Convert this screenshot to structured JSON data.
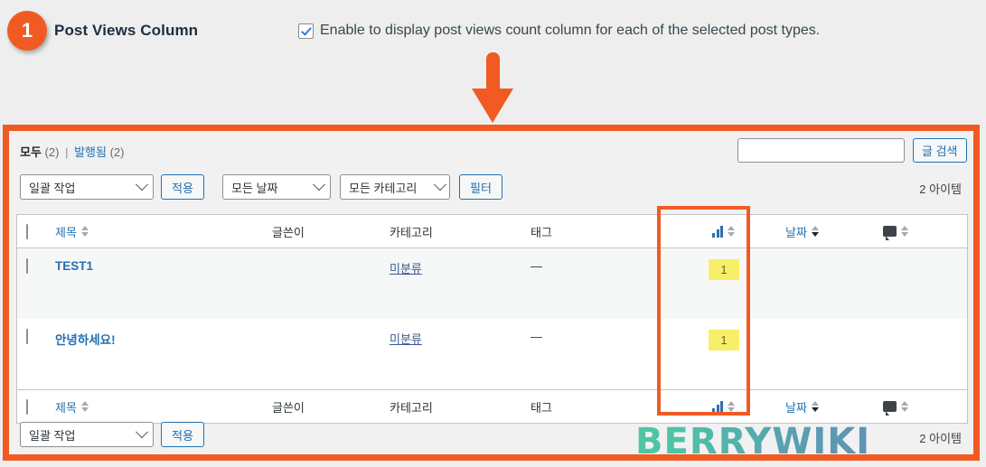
{
  "annotation": {
    "badge_number": "1",
    "title": "Post Views Column",
    "checkbox_label": "Enable to display post views count column for each of the selected post types.",
    "accent_color": "#f15a22",
    "arrow_icon": "arrow-down-icon"
  },
  "list_table": {
    "views_nav": {
      "all_label": "모두",
      "all_count": "(2)",
      "separator": "|",
      "published_label": "발행됨",
      "published_count": "(2)"
    },
    "search": {
      "value": "",
      "placeholder": "",
      "button_label": "글 검색"
    },
    "toolbar_top": {
      "bulk_action_value": "일괄 작업",
      "apply_label": "적용",
      "date_filter_value": "모든 날짜",
      "category_filter_value": "모든 카테고리",
      "filter_label": "필터"
    },
    "toolbar_bottom": {
      "bulk_action_value": "일괄 작업",
      "apply_label": "적용"
    },
    "item_count_top": "2 아이템",
    "item_count_bottom": "2 아이템",
    "columns": {
      "title": "제목",
      "author": "글쓴이",
      "category": "카테고리",
      "tag": "태그",
      "views_icon": "bar-chart-icon",
      "date": "날짜",
      "comments_icon": "comment-bubble-icon"
    },
    "rows": [
      {
        "title": "TEST1",
        "author": "",
        "category": "미분류",
        "tag": "—",
        "views": "1",
        "date": "",
        "comments": ""
      },
      {
        "title": "안녕하세요!",
        "author": "",
        "category": "미분류",
        "tag": "—",
        "views": "1",
        "date": "",
        "comments": ""
      }
    ],
    "views_highlight_color": "#f15a22",
    "views_badge_color": "#f7ef6a"
  },
  "watermark": {
    "text": "BERRYWIKI"
  }
}
